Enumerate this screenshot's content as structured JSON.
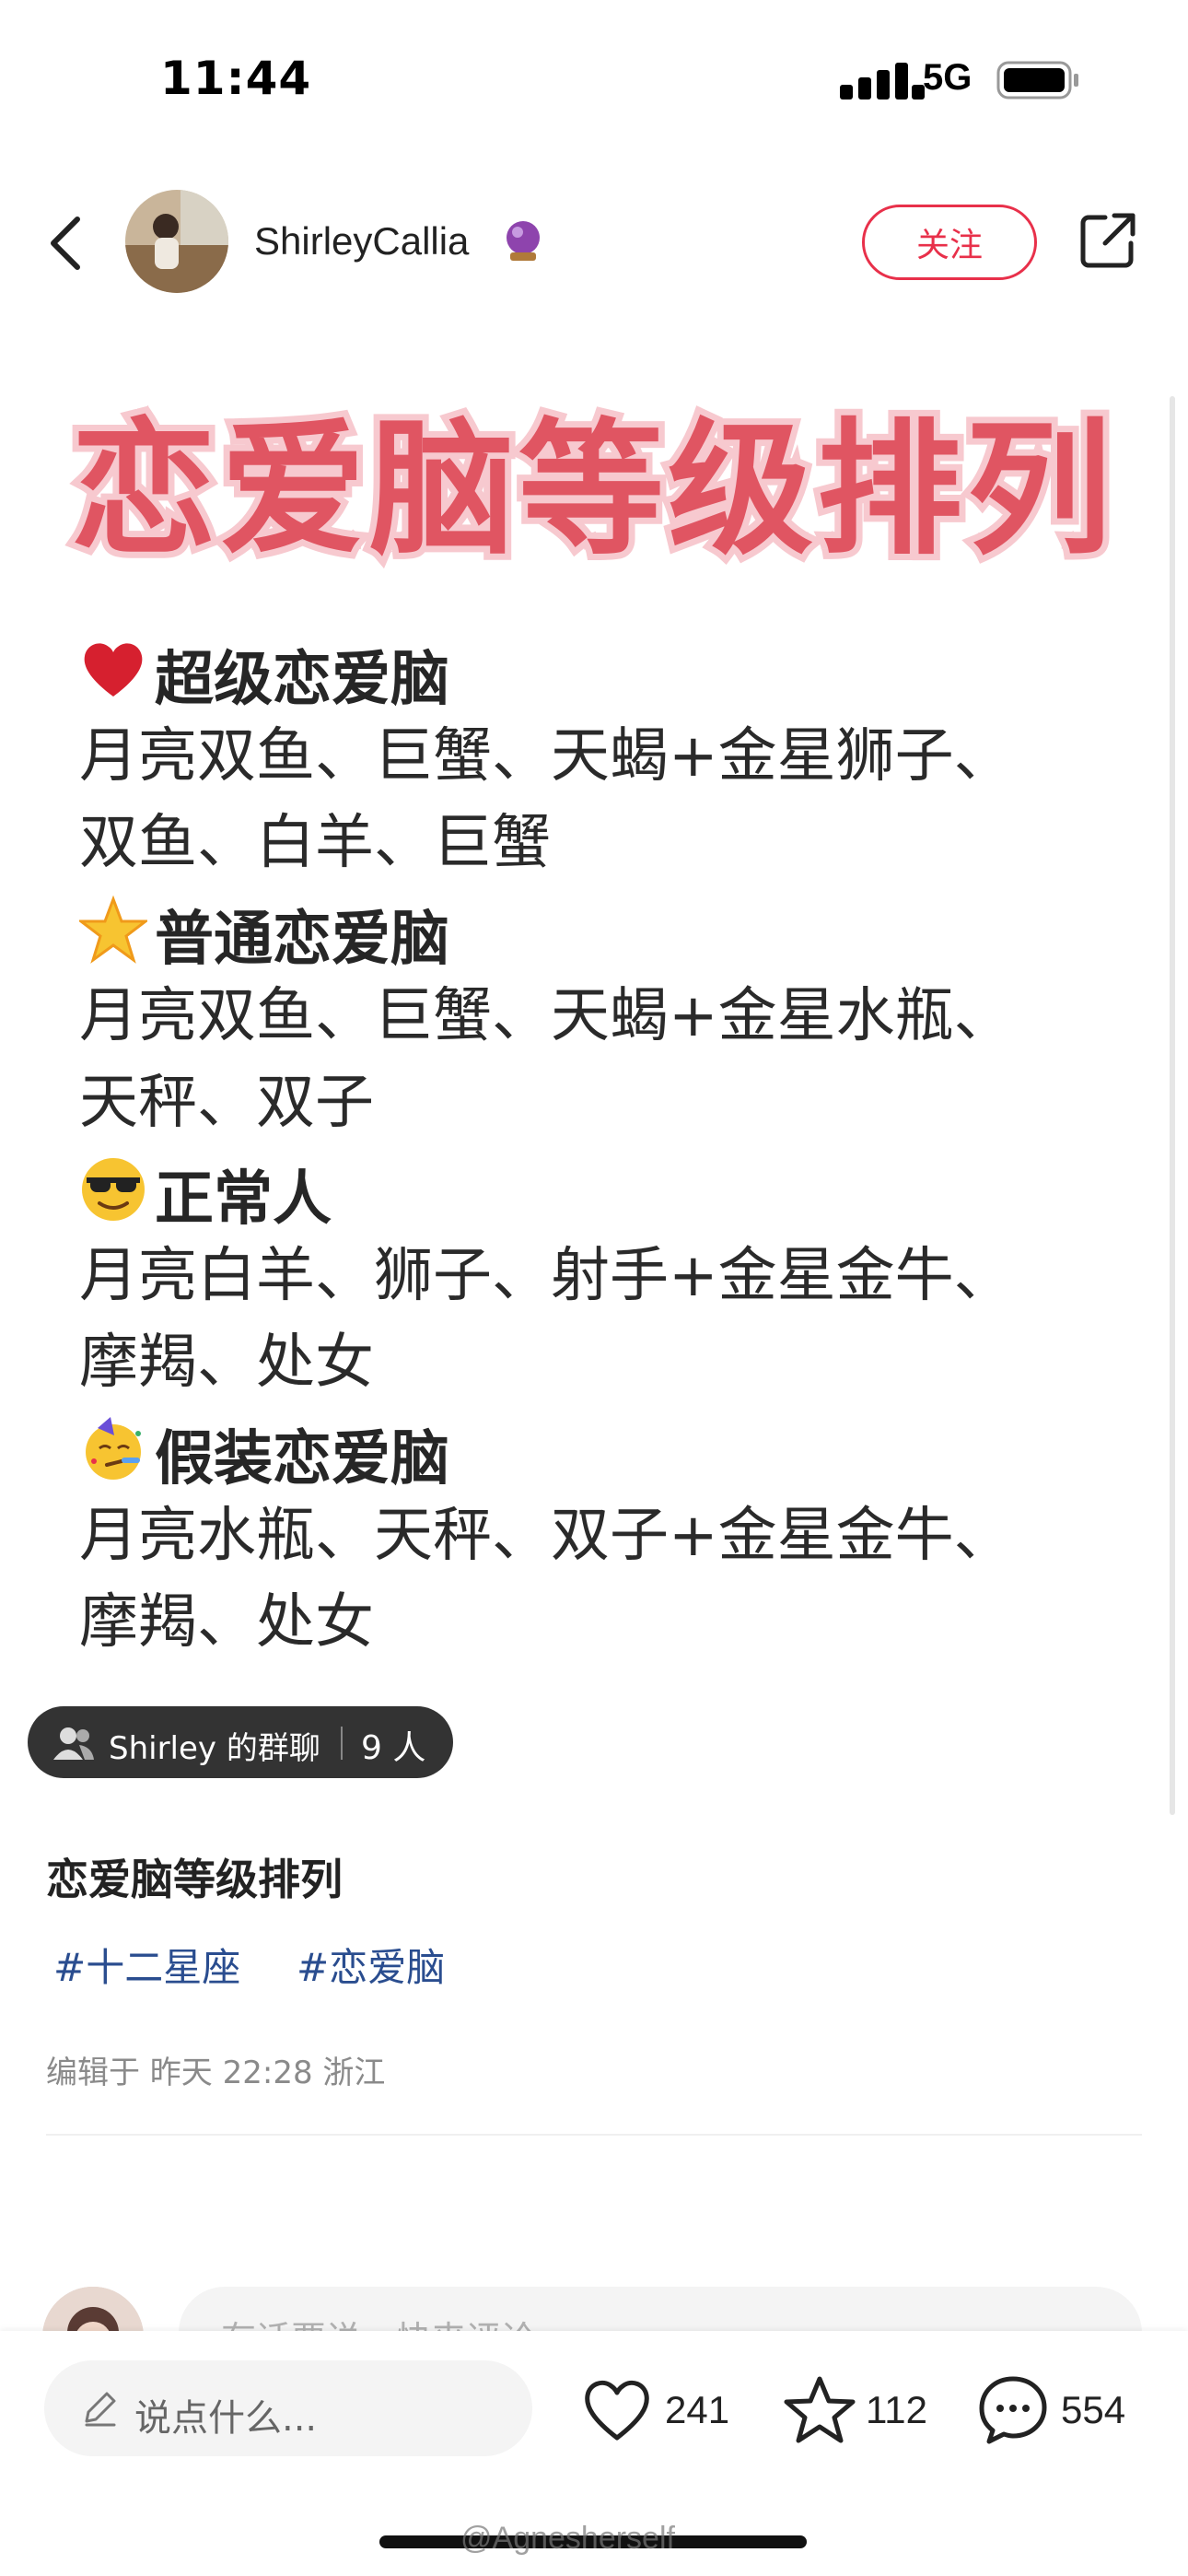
{
  "status_bar": {
    "time": "11:44",
    "network": "5G"
  },
  "header": {
    "username": "ShirleyCallia",
    "follow_label": "关注",
    "badge_icon": "crystal-ball-icon"
  },
  "image": {
    "headline": "恋爱脑等级排列",
    "sections": [
      {
        "icon": "red-heart-icon",
        "title": "超级恋爱脑",
        "lines": [
          "月亮双鱼、巨蟹、天蝎+金星狮子、",
          "双鱼、白羊、巨蟹"
        ]
      },
      {
        "icon": "glowing-star-icon",
        "title": "普通恋爱脑",
        "lines": [
          "月亮双鱼、巨蟹、天蝎+金星水瓶、",
          "天秤、双子"
        ]
      },
      {
        "icon": "sunglasses-face-icon",
        "title": "正常人",
        "lines": [
          "月亮白羊、狮子、射手+金星金牛、",
          "摩羯、处女"
        ]
      },
      {
        "icon": "party-face-icon",
        "title": "假装恋爱脑",
        "lines": [
          "月亮水瓶、天秤、双子+金星金牛、",
          "摩羯、处女"
        ]
      }
    ]
  },
  "group_chat": {
    "name": "Shirley 的群聊",
    "count": "9 人"
  },
  "note": {
    "title": "恋爱脑等级排列",
    "tags": [
      "#十二星座",
      "#恋爱脑"
    ],
    "edit_info": "编辑于 昨天 22:28 浙江"
  },
  "comment": {
    "placeholder": "有话要说，快来评论"
  },
  "bottom_bar": {
    "input_placeholder": "说点什么...",
    "likes": "241",
    "collects": "112",
    "comments": "554"
  },
  "watermark": "@Agnesherself",
  "colors": {
    "accent": "#e8304a",
    "headline_fill": "#e05562",
    "tag": "#2a4d8f"
  }
}
